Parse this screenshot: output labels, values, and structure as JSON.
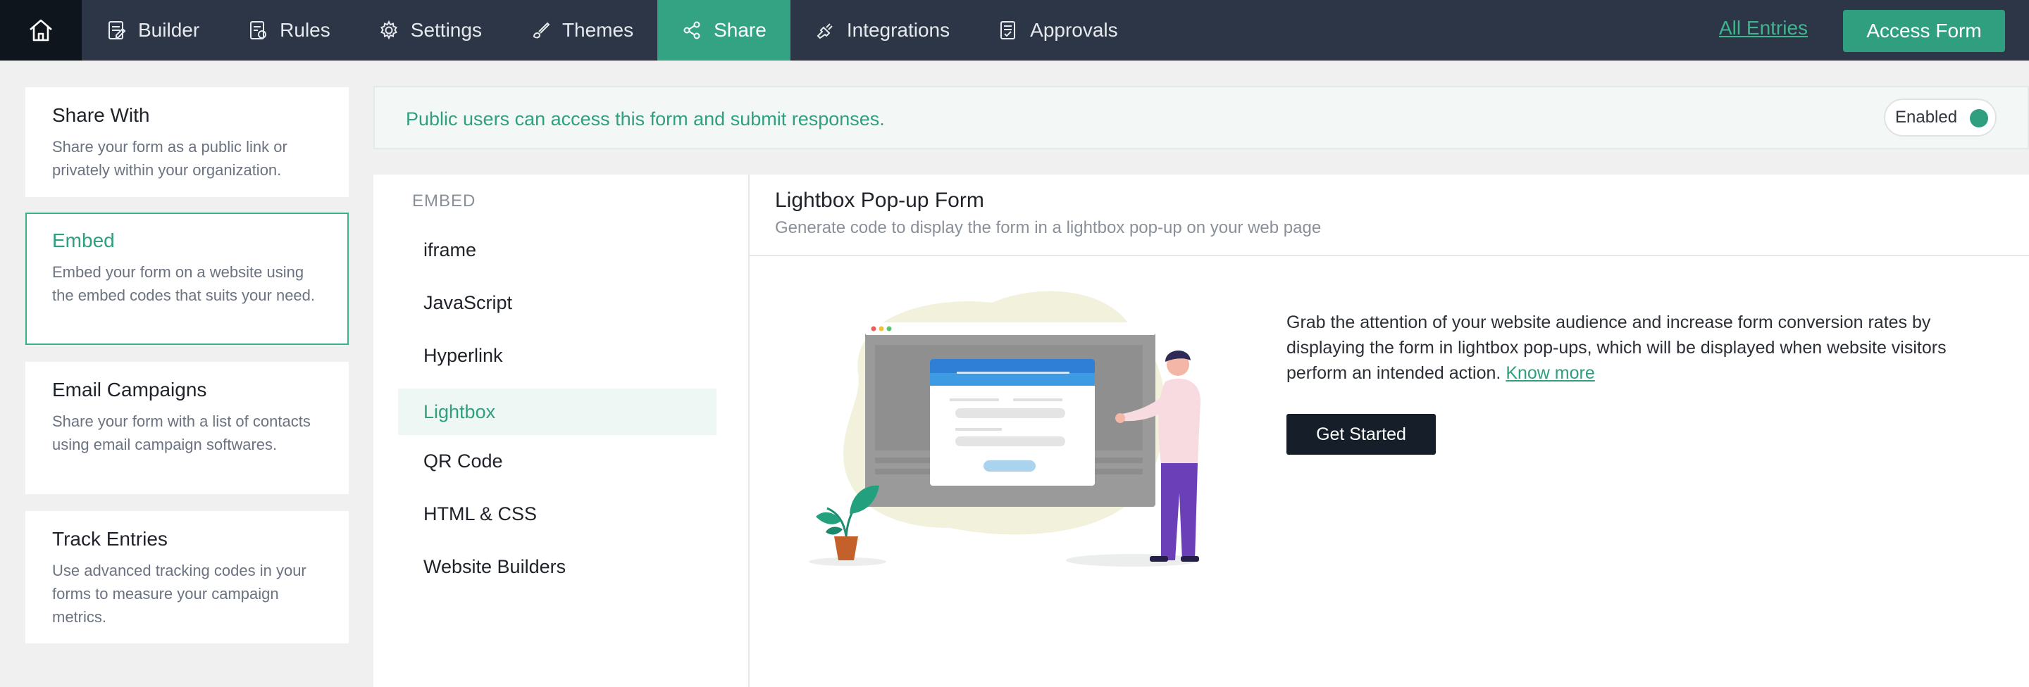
{
  "topbar": {
    "nav": [
      {
        "label": "Builder",
        "icon": "builder-icon"
      },
      {
        "label": "Rules",
        "icon": "rules-icon"
      },
      {
        "label": "Settings",
        "icon": "settings-icon"
      },
      {
        "label": "Themes",
        "icon": "themes-icon"
      },
      {
        "label": "Share",
        "icon": "share-icon",
        "active": true
      },
      {
        "label": "Integrations",
        "icon": "integrations-icon"
      },
      {
        "label": "Approvals",
        "icon": "approvals-icon"
      }
    ],
    "all_entries": "All Entries",
    "access_form": "Access Form"
  },
  "sidebar": {
    "cards": [
      {
        "title": "Share With",
        "desc": "Share your form as a public link or privately within your organization."
      },
      {
        "title": "Embed",
        "desc": "Embed your form on a website using the embed codes that suits your need.",
        "active": true
      },
      {
        "title": "Email Campaigns",
        "desc": "Share your form with a list of contacts using email campaign softwares."
      },
      {
        "title": "Track Entries",
        "desc": "Use advanced tracking codes in your forms to measure your campaign metrics."
      }
    ]
  },
  "banner": {
    "text": "Public users can access this form and submit responses.",
    "toggle_label": "Enabled",
    "toggle_on": true
  },
  "embed": {
    "heading": "EMBED",
    "items": [
      "iframe",
      "JavaScript",
      "Hyperlink",
      "Lightbox",
      "QR Code",
      "HTML & CSS",
      "Website Builders"
    ],
    "active": "Lightbox"
  },
  "content": {
    "title": "Lightbox Pop-up Form",
    "subtitle": "Generate code to display the form in a lightbox pop-up on your web page",
    "description": "Grab the attention of your website audience and increase form conversion rates by displaying the form in lightbox pop-ups, which will be displayed when website visitors perform an intended action.",
    "know_more": "Know more",
    "button": "Get Started"
  },
  "colors": {
    "topbar": "#2c3646",
    "home": "#0f151d",
    "accent": "#2f9f80",
    "dark_button": "#161e29"
  }
}
